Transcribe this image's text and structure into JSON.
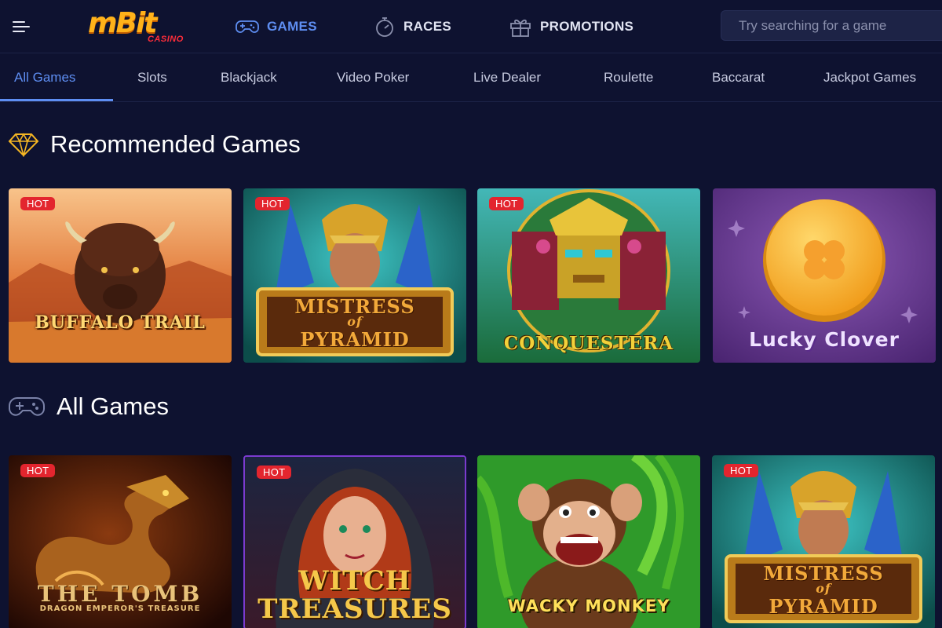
{
  "header": {
    "logo_text": "mBit",
    "logo_sub": "CASINO",
    "nav": [
      {
        "label": "GAMES",
        "icon": "gamepad-icon",
        "active": true
      },
      {
        "label": "RACES",
        "icon": "stopwatch-icon",
        "active": false
      },
      {
        "label": "PROMOTIONS",
        "icon": "gift-icon",
        "active": false
      }
    ],
    "search_placeholder": "Try searching for a game"
  },
  "tabs": [
    "All Games",
    "Slots",
    "Blackjack",
    "Video Poker",
    "Live Dealer",
    "Roulette",
    "Baccarat",
    "Jackpot Games"
  ],
  "active_tab": "All Games",
  "sections": {
    "recommended": {
      "title": "Recommended Games",
      "icon": "diamond-icon",
      "games": [
        {
          "title": "BUFFALO TRAIL",
          "badge": "HOT"
        },
        {
          "title_line1": "MISTRESS",
          "title_line2": "of",
          "title_line3": "PYRAMID",
          "badge": "HOT"
        },
        {
          "title": "CONQUESTERA",
          "badge": "HOT"
        },
        {
          "title": "Lucky Clover",
          "badge": ""
        }
      ]
    },
    "all": {
      "title": "All Games",
      "icon": "gamepad-icon",
      "games": [
        {
          "title": "THE TOMB",
          "subtitle": "DRAGON EMPEROR'S TREASURE",
          "badge": "HOT"
        },
        {
          "title_line1": "WITCH",
          "title_line2": "TREASURES",
          "badge": "HOT"
        },
        {
          "title": "WACKY MONKEY",
          "badge": ""
        },
        {
          "title_line1": "MISTRESS",
          "title_line2": "of",
          "title_line3": "PYRAMID",
          "badge": "HOT"
        }
      ]
    }
  },
  "colors": {
    "background": "#0e1230",
    "accent": "#5e8ef2",
    "hot_badge": "#e3252e",
    "logo": "#ffb21a"
  }
}
